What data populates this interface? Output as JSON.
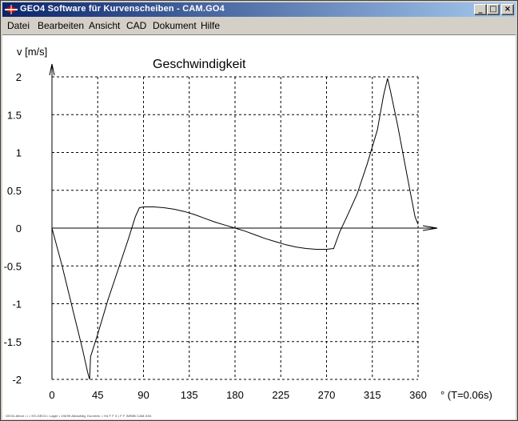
{
  "window": {
    "title": "GEO4  Software für Kurvenscheiben  -  CAM.GO4",
    "buttons": {
      "minimize": "_",
      "maximize": "□",
      "close": "×"
    }
  },
  "menu": [
    {
      "label": "Datei"
    },
    {
      "label": "Bearbeiten"
    },
    {
      "label": "Ansicht"
    },
    {
      "label": "CAD"
    },
    {
      "label": "Dokument"
    },
    {
      "label": "Hilfe"
    }
  ],
  "footer": {
    "text": "GEO4-Mech • • • KS-GEO4 • Lager • 2/6/99 Ablaufdig. Kurvenb. • H4 F F 3 • F F WEBB CAM.G04"
  },
  "chart_data": {
    "type": "line",
    "title": "Geschwindigkeit",
    "xlabel": "° (T=0.06s)",
    "ylabel": "v [m/s]",
    "xlim": [
      0,
      360
    ],
    "ylim": [
      -2,
      2
    ],
    "grid": true,
    "x_ticks": [
      "0",
      "45",
      "90",
      "135",
      "180",
      "225",
      "270",
      "315",
      "360"
    ],
    "y_ticks": [
      "2",
      "1.5",
      "1",
      "0.5",
      "0",
      "-0.5",
      "-1",
      "-1.5",
      "-2"
    ],
    "series": [
      {
        "values": [
          [
            0,
            0
          ],
          [
            10,
            -0.5
          ],
          [
            20,
            -1.05
          ],
          [
            30,
            -1.6
          ],
          [
            35,
            -1.9
          ],
          [
            37,
            -2.0
          ],
          [
            38,
            -1.7
          ],
          [
            45,
            -1.4
          ],
          [
            55,
            -0.95
          ],
          [
            65,
            -0.55
          ],
          [
            75,
            -0.15
          ],
          [
            82,
            0.15
          ],
          [
            86,
            0.27
          ],
          [
            90,
            0.28
          ],
          [
            100,
            0.28
          ],
          [
            110,
            0.27
          ],
          [
            120,
            0.25
          ],
          [
            130,
            0.22
          ],
          [
            140,
            0.18
          ],
          [
            150,
            0.13
          ],
          [
            160,
            0.08
          ],
          [
            170,
            0.04
          ],
          [
            180,
            0.0
          ],
          [
            190,
            -0.04
          ],
          [
            200,
            -0.09
          ],
          [
            210,
            -0.14
          ],
          [
            220,
            -0.18
          ],
          [
            230,
            -0.22
          ],
          [
            240,
            -0.25
          ],
          [
            250,
            -0.27
          ],
          [
            260,
            -0.28
          ],
          [
            270,
            -0.28
          ],
          [
            277,
            -0.27
          ],
          [
            283,
            -0.05
          ],
          [
            290,
            0.15
          ],
          [
            300,
            0.45
          ],
          [
            310,
            0.85
          ],
          [
            320,
            1.3
          ],
          [
            326,
            1.75
          ],
          [
            330,
            1.98
          ],
          [
            333,
            1.8
          ],
          [
            340,
            1.35
          ],
          [
            347,
            0.85
          ],
          [
            352,
            0.5
          ],
          [
            357,
            0.15
          ],
          [
            360,
            0.05
          ]
        ]
      }
    ]
  }
}
